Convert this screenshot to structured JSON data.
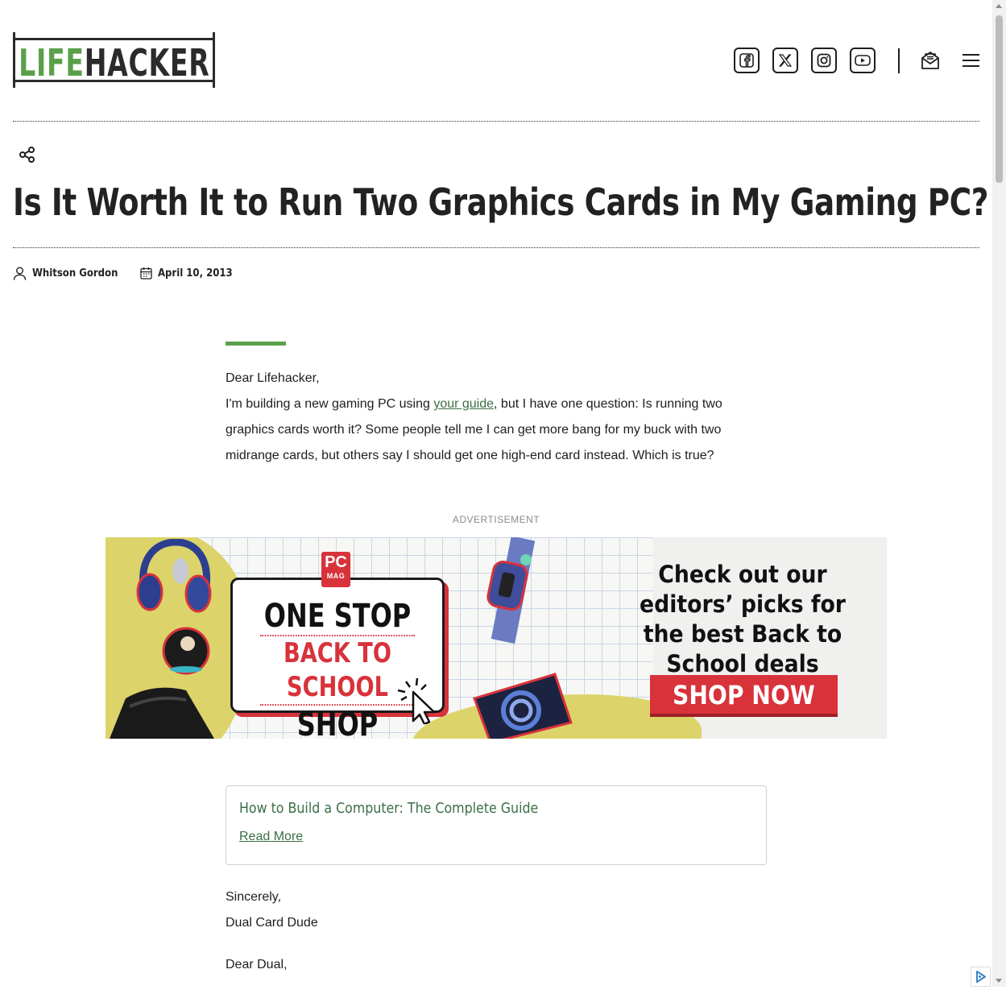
{
  "header": {
    "logo_life": "LIFE",
    "logo_hacker": "HACKER",
    "social": [
      {
        "icon": "facebook-icon"
      },
      {
        "icon": "x-twitter-icon"
      },
      {
        "icon": "instagram-icon"
      },
      {
        "icon": "youtube-icon"
      }
    ]
  },
  "article": {
    "title": "Is It Worth It to Run Two Graphics Cards in My Gaming PC?",
    "author": "Whitson Gordon",
    "date": "April 10, 2013",
    "greeting": "Dear Lifehacker,",
    "question_before_link": "I'm building a new gaming PC using ",
    "question_link": "your guide",
    "question_after_link": ", but I have one question: Is running two graphics cards worth it? Some people tell me I can get more bang for my buck with two midrange cards, but others say I should get one high-end card instead. Which is true?",
    "signoff": "Sincerely,",
    "signoff_name": "Dual Card Dude",
    "reply_greeting": "Dear Dual,"
  },
  "ad": {
    "label": "ADVERTISEMENT",
    "badge_top": "PC",
    "badge_bottom": "MAG",
    "line1": "ONE STOP",
    "line2": "BACK TO SCHOOL",
    "line3": "SHOP",
    "copy": "Check out our editors’ picks for the best Back to School deals",
    "cta": "SHOP NOW"
  },
  "related": {
    "title": "How to Build a Computer: The Complete Guide",
    "link": "Read More"
  },
  "colors": {
    "brand_green": "#5aa04a",
    "link_green": "#3b6e46",
    "ad_red": "#d8323b"
  }
}
